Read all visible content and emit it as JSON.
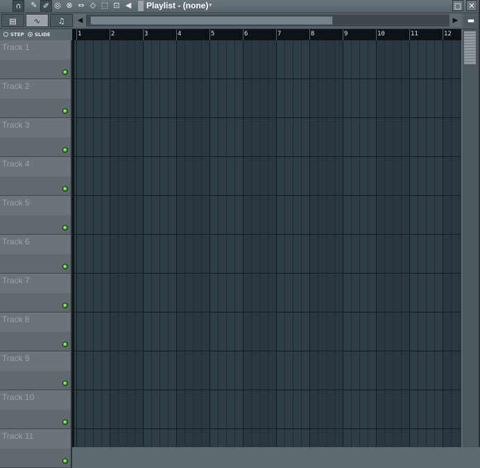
{
  "titlebar": {
    "tools": [
      {
        "icon": "magnet-icon",
        "glyph": "∩"
      },
      {
        "icon": "pencil-icon",
        "glyph": "✎"
      },
      {
        "icon": "paint-brush-icon",
        "glyph": "✐"
      },
      {
        "icon": "delete-tool-icon",
        "glyph": "◎"
      },
      {
        "icon": "mute-tool-icon",
        "glyph": "⊗"
      },
      {
        "icon": "slip-tool-icon",
        "glyph": "⇔"
      },
      {
        "icon": "slice-tool-icon",
        "glyph": "◇"
      },
      {
        "icon": "select-tool-icon",
        "glyph": "⬚"
      },
      {
        "icon": "zoom-tool-icon",
        "glyph": "⊡"
      },
      {
        "icon": "speaker-icon",
        "glyph": "◀"
      }
    ],
    "title": "Playlist - (none)",
    "dropdown_glyph": "▾",
    "maximize_glyph": "□",
    "close_glyph": "✕"
  },
  "toolbar2": {
    "tabs": [
      {
        "icon": "pattern-icon",
        "glyph": "▤",
        "active": false
      },
      {
        "icon": "automation-icon",
        "glyph": "∿",
        "active": true
      },
      {
        "icon": "note-icon",
        "glyph": "♫",
        "active": false
      }
    ],
    "scroll_left_glyph": "◀",
    "scroll_right_glyph": "▶",
    "corner_glyph": "▬"
  },
  "mode": {
    "step_label": "STEP",
    "slide_label": "SLIDE",
    "selected": "slide"
  },
  "ruler": {
    "bars": [
      "1",
      "2",
      "3",
      "4",
      "5",
      "6",
      "7",
      "8",
      "9",
      "10",
      "11",
      "12"
    ]
  },
  "tracks": [
    "Track 1",
    "Track 2",
    "Track 3",
    "Track 4",
    "Track 5",
    "Track 6",
    "Track 7",
    "Track 8",
    "Track 9",
    "Track 10",
    "Track 11"
  ],
  "colors": {
    "grid_bg": "#2e3c46",
    "grid_bg_alt": "#2a3741",
    "grid_line": "#1f2a32",
    "bar_line": "#151d23",
    "row_line": "#141b20",
    "led": "#3aa52a"
  }
}
